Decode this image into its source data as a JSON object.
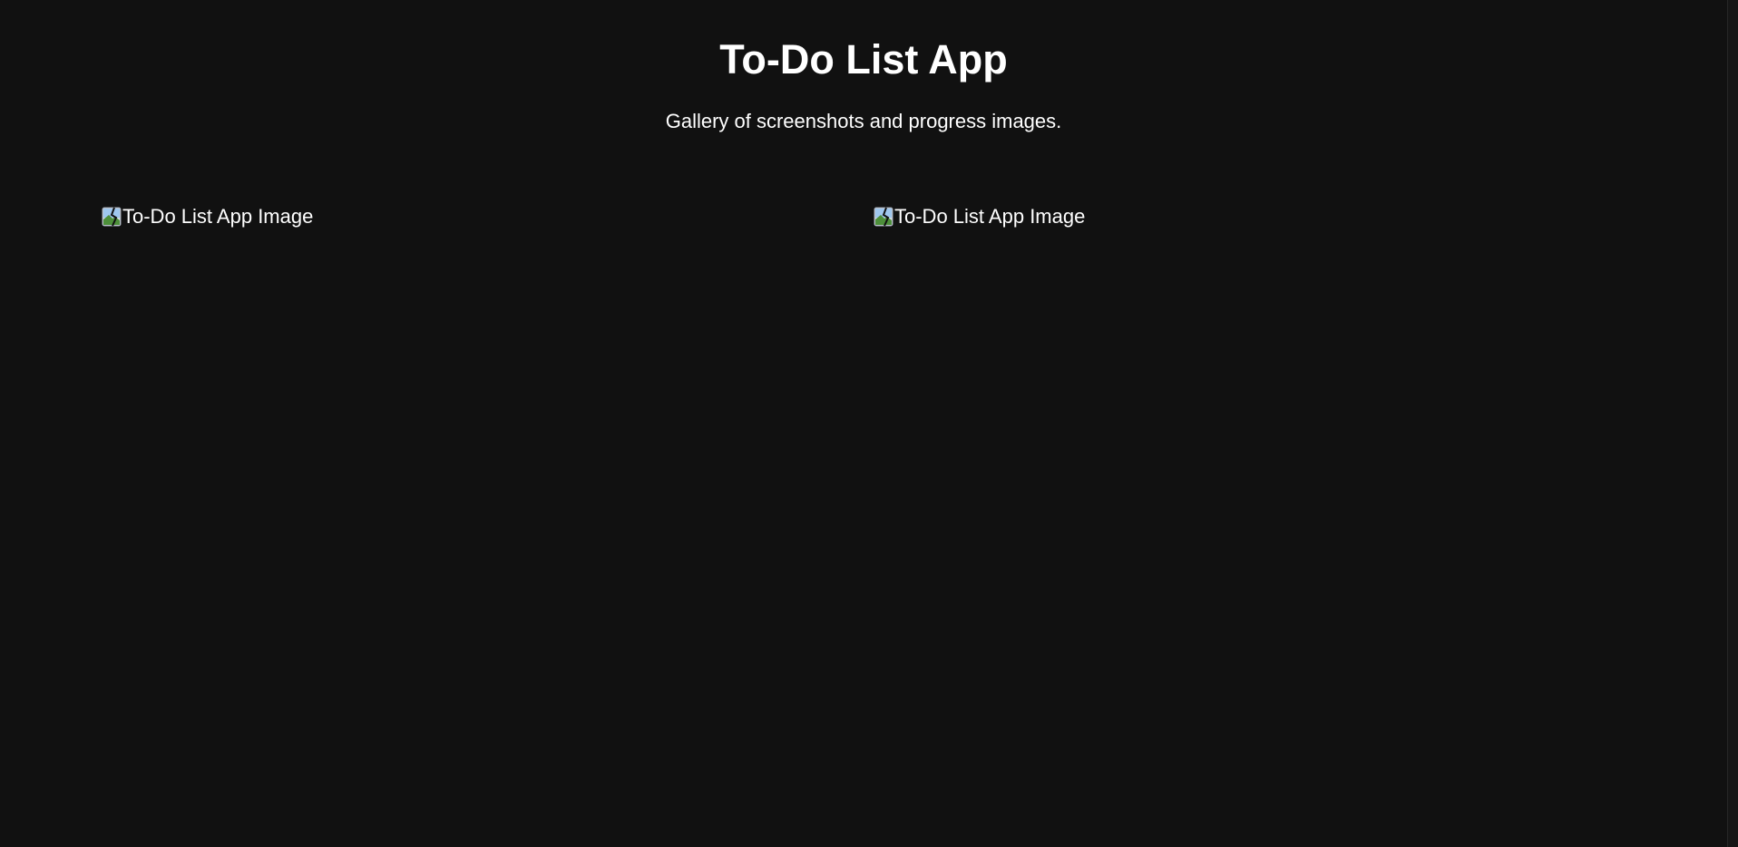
{
  "header": {
    "title": "To-Do List App",
    "subtitle": "Gallery of screenshots and progress images."
  },
  "gallery": {
    "items": [
      {
        "alt": "To-Do List App Image",
        "icon": "broken-image-icon"
      },
      {
        "alt": "To-Do List App Image",
        "icon": "broken-image-icon"
      }
    ]
  },
  "colors": {
    "background": "#111111",
    "text": "#ffffff"
  }
}
